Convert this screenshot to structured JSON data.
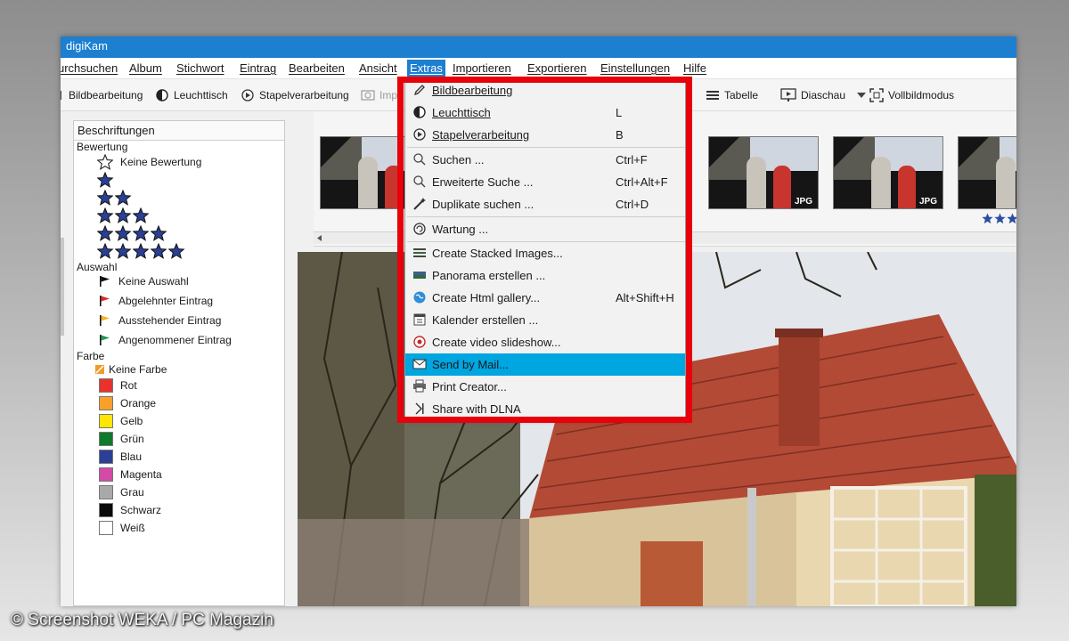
{
  "window": {
    "title": "digiKam"
  },
  "menubar": {
    "items": [
      "urchsuchen",
      "Album",
      "Stichwort",
      "Eintrag",
      "Bearbeiten",
      "Ansicht",
      "Extras",
      "Importieren",
      "Exportieren",
      "Einstellungen",
      "Hilfe"
    ],
    "active": "Extras"
  },
  "toolbar": {
    "left": [
      {
        "label": "Bildbearbeitung",
        "icon": "pencil-icon"
      },
      {
        "label": "Leuchttisch",
        "icon": "lighttable-icon"
      },
      {
        "label": "Stapelverarbeitung",
        "icon": "batch-icon"
      },
      {
        "label": "Imp",
        "icon": "import-icon"
      }
    ],
    "right": [
      {
        "label": "Tabelle",
        "icon": "table-icon"
      },
      {
        "label": "Diaschau",
        "icon": "slideshow-icon"
      },
      {
        "label": "Vollbildmodus",
        "icon": "fullscreen-icon"
      }
    ]
  },
  "left_panel": {
    "title": "Beschriftungen",
    "rating_label": "Bewertung",
    "no_rating": "Keine Bewertung",
    "star_rows": [
      1,
      2,
      3,
      4,
      5
    ],
    "pick_label": "Auswahl",
    "picks": [
      {
        "label": "Keine Auswahl",
        "color": "#111111"
      },
      {
        "label": "Abgelehnter Eintrag",
        "color": "#e0262a"
      },
      {
        "label": "Ausstehender Eintrag",
        "color": "#f3b41a"
      },
      {
        "label": "Angenommener Eintrag",
        "color": "#1e9b4e"
      }
    ],
    "color_label": "Farbe",
    "no_color": "Keine Farbe",
    "colors": [
      {
        "label": "Rot",
        "color": "#e8322b"
      },
      {
        "label": "Orange",
        "color": "#f7a12a"
      },
      {
        "label": "Gelb",
        "color": "#ffe600"
      },
      {
        "label": "Grün",
        "color": "#0f7a2a"
      },
      {
        "label": "Blau",
        "color": "#2b3f96"
      },
      {
        "label": "Magenta",
        "color": "#d44aa6"
      },
      {
        "label": "Grau",
        "color": "#a9a9a9"
      },
      {
        "label": "Schwarz",
        "color": "#0a0a0a"
      },
      {
        "label": "Weiß",
        "color": "#ffffff"
      }
    ]
  },
  "thumbnails": {
    "badge": "JPG",
    "count": 7,
    "last_rating": 3
  },
  "extras_menu": {
    "items": [
      {
        "label": "Bildbearbeitung",
        "shortcut": "",
        "icon": "pencil-icon"
      },
      {
        "label": "Leuchttisch",
        "shortcut": "L",
        "icon": "lighttable-icon"
      },
      {
        "label": "Stapelverarbeitung",
        "shortcut": "B",
        "icon": "batch-icon"
      },
      {
        "label": "Suchen ...",
        "shortcut": "Ctrl+F",
        "icon": "search-icon"
      },
      {
        "label": "Erweiterte Suche ...",
        "shortcut": "Ctrl+Alt+F",
        "icon": "advanced-search-icon"
      },
      {
        "label": "Duplikate suchen ...",
        "shortcut": "Ctrl+D",
        "icon": "magic-wand-icon"
      },
      {
        "label": "Wartung ...",
        "shortcut": "",
        "icon": "maintenance-icon"
      },
      {
        "label": "Create Stacked Images...",
        "shortcut": "",
        "icon": "stacked-images-icon"
      },
      {
        "label": "Panorama erstellen ...",
        "shortcut": "",
        "icon": "panorama-icon"
      },
      {
        "label": "Create Html gallery...",
        "shortcut": "Alt+Shift+H",
        "icon": "globe-icon"
      },
      {
        "label": "Kalender erstellen ...",
        "shortcut": "",
        "icon": "calendar-icon"
      },
      {
        "label": "Create video slideshow...",
        "shortcut": "",
        "icon": "video-icon"
      },
      {
        "label": "Send by Mail...",
        "shortcut": "",
        "icon": "mail-icon"
      },
      {
        "label": "Print Creator...",
        "shortcut": "",
        "icon": "printer-icon"
      },
      {
        "label": "Share with DLNA",
        "shortcut": "",
        "icon": "dlna-icon"
      }
    ],
    "highlighted": "Send by Mail..."
  },
  "watermark": "© Screenshot WEKA / PC Magazin",
  "accent": "#1c7fd0",
  "highlight": "#00a6e0",
  "frame_color": "#e8000b"
}
